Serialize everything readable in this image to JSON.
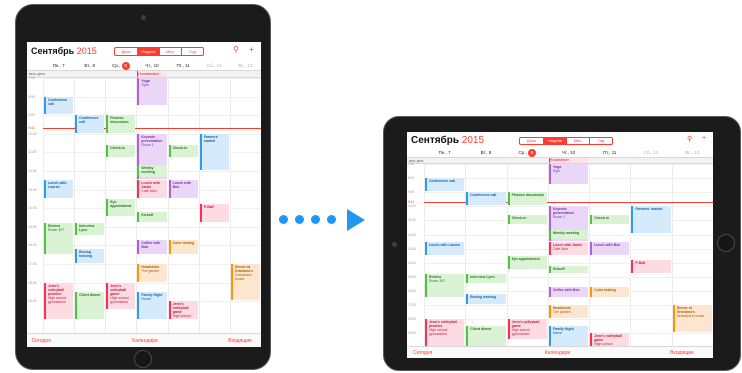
{
  "calendar": {
    "month": "Сентябрь",
    "year": "2015",
    "views": [
      "День",
      "Неделя",
      "Мес.",
      "Год"
    ],
    "active_view": 1,
    "days": [
      {
        "name": "Пн",
        "num": "7",
        "weekend": false,
        "today": false
      },
      {
        "name": "Вт",
        "num": "8",
        "weekend": false,
        "today": false
      },
      {
        "name": "Ср",
        "num": "9",
        "weekend": false,
        "today": true
      },
      {
        "name": "Чт",
        "num": "10",
        "weekend": false,
        "today": false
      },
      {
        "name": "Пт",
        "num": "11",
        "weekend": false,
        "today": false
      },
      {
        "name": "Сб",
        "num": "12",
        "weekend": true,
        "today": false
      },
      {
        "name": "Вс",
        "num": "13",
        "weekend": true,
        "today": false
      }
    ],
    "allday_label": "весь день",
    "allday_event": {
      "title": "Housekeeper",
      "day": 3
    },
    "hours": [
      "7:00",
      "8:00",
      "9:00",
      "10:00",
      "11:00",
      "12:00",
      "13:00",
      "14:00",
      "15:00",
      "16:00",
      "17:00",
      "18:00",
      "19:00"
    ],
    "now_label": "9:41",
    "now_hour": 9.68,
    "events": [
      {
        "title": "Yoga",
        "sub": "Gym",
        "day": 3,
        "start": 7.0,
        "end": 8.5,
        "color": "purple"
      },
      {
        "title": "Conference call",
        "sub": "",
        "day": 0,
        "start": 8.0,
        "end": 9.0,
        "color": "blue"
      },
      {
        "title": "Conference call",
        "sub": "",
        "day": 1,
        "start": 9.0,
        "end": 10.0,
        "color": "blue"
      },
      {
        "title": "Finance discussion",
        "sub": "",
        "day": 2,
        "start": 9.0,
        "end": 10.0,
        "color": "green"
      },
      {
        "title": "Keynote presentation",
        "sub": "Room 1",
        "day": 3,
        "start": 10.0,
        "end": 12.5,
        "color": "purple"
      },
      {
        "title": "Farmers' market",
        "sub": "",
        "day": 5,
        "start": 10.0,
        "end": 12.0,
        "color": "blue"
      },
      {
        "title": "Check-in",
        "sub": "",
        "day": 2,
        "start": 10.6,
        "end": 11.3,
        "color": "green"
      },
      {
        "title": "Check-in",
        "sub": "",
        "day": 4,
        "start": 10.6,
        "end": 11.3,
        "color": "green"
      },
      {
        "title": "Weekly meeting",
        "sub": "",
        "day": 3,
        "start": 11.7,
        "end": 12.4,
        "color": "green"
      },
      {
        "title": "Lunch with Lauren",
        "sub": "",
        "day": 0,
        "start": 12.5,
        "end": 13.5,
        "color": "blue"
      },
      {
        "title": "Lunch with Jamie",
        "sub": "Café Mon",
        "day": 3,
        "start": 12.5,
        "end": 13.5,
        "color": "red"
      },
      {
        "title": "Lunch with Ben",
        "sub": "",
        "day": 4,
        "start": 12.5,
        "end": 13.5,
        "color": "purple"
      },
      {
        "title": "Eye appointment",
        "sub": "",
        "day": 2,
        "start": 13.5,
        "end": 14.5,
        "color": "green"
      },
      {
        "title": "P-Ball",
        "sub": "",
        "day": 5,
        "start": 13.8,
        "end": 14.8,
        "color": "red"
      },
      {
        "title": "Kickoff",
        "sub": "",
        "day": 3,
        "start": 14.2,
        "end": 14.8,
        "color": "green"
      },
      {
        "title": "Review",
        "sub": "Room 307",
        "day": 0,
        "start": 14.8,
        "end": 16.5,
        "color": "green"
      },
      {
        "title": "Interview Lynn",
        "sub": "",
        "day": 1,
        "start": 14.8,
        "end": 15.5,
        "color": "green"
      },
      {
        "title": "Coffee with Bob",
        "sub": "",
        "day": 3,
        "start": 15.7,
        "end": 16.5,
        "color": "purple"
      },
      {
        "title": "Color testing",
        "sub": "",
        "day": 4,
        "start": 15.7,
        "end": 16.5,
        "color": "orange"
      },
      {
        "title": "Boxing training",
        "sub": "",
        "day": 1,
        "start": 16.2,
        "end": 17.0,
        "color": "blue"
      },
      {
        "title": "Headshots",
        "sub": "The garden",
        "day": 3,
        "start": 17.0,
        "end": 18.0,
        "color": "orange"
      },
      {
        "title": "Dinner at Grandma's",
        "sub": "Grandma's house",
        "day": 6,
        "start": 17.0,
        "end": 19.0,
        "color": "orange"
      },
      {
        "title": "Jenn's volleyball practice",
        "sub": "High school gymnasium",
        "day": 0,
        "start": 18.0,
        "end": 20.0,
        "color": "red"
      },
      {
        "title": "Jenn's volleyball game",
        "sub": "High school gymnasium",
        "day": 2,
        "start": 18.0,
        "end": 19.5,
        "color": "red"
      },
      {
        "title": "Family Night",
        "sub": "Home",
        "day": 3,
        "start": 18.5,
        "end": 20.0,
        "color": "blue"
      },
      {
        "title": "Client dinner",
        "sub": "",
        "day": 1,
        "start": 18.5,
        "end": 20.0,
        "color": "green"
      },
      {
        "title": "Jenn's volleyball game",
        "sub": "High school gymnasium",
        "day": 4,
        "start": 19.0,
        "end": 20.0,
        "color": "red"
      }
    ],
    "tabs": [
      "Сегодня",
      "Календари",
      "Входящие"
    ],
    "search_icon": "⚲",
    "add_icon": "+"
  },
  "colors": {
    "accent": "#ff3b30",
    "arrow": "#2196f3"
  }
}
